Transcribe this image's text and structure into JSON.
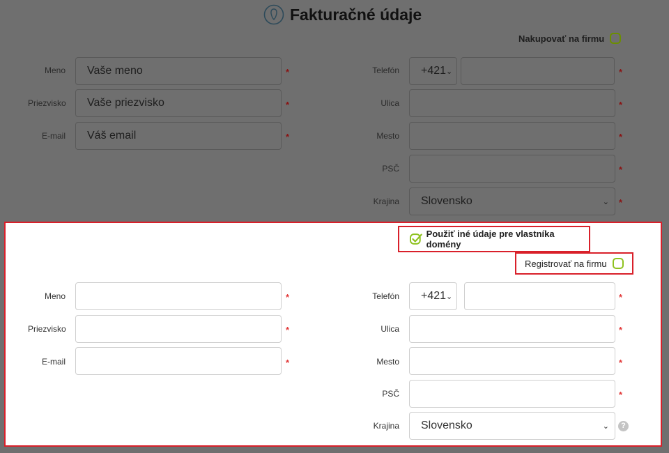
{
  "page": {
    "title": "Fakturačné údaje"
  },
  "billing": {
    "company_toggle_label": "Nakupovať na firmu",
    "labels": {
      "name": "Meno",
      "surname": "Priezvisko",
      "email": "E-mail",
      "phone": "Telefón",
      "street": "Ulica",
      "city": "Mesto",
      "zip": "PSČ",
      "country": "Krajina"
    },
    "placeholders": {
      "name": "Vaše meno",
      "surname": "Vaše priezvisko",
      "email": "Váš email"
    },
    "phone_prefix": "+421",
    "country_value": "Slovensko",
    "required_mark": "*"
  },
  "owner": {
    "use_other_label": "Použiť iné údaje pre vlastníka domény",
    "use_other_checked": true,
    "register_company_label": "Registrovať na firmu",
    "labels": {
      "name": "Meno",
      "surname": "Priezvisko",
      "email": "E-mail",
      "phone": "Telefón",
      "street": "Ulica",
      "city": "Mesto",
      "zip": "PSČ",
      "country": "Krajina"
    },
    "phone_prefix": "+421",
    "country_value": "Slovensko",
    "required_mark": "*",
    "help_glyph": "?"
  },
  "colors": {
    "accent_green": "#8ec21f",
    "highlight_red": "#d9202a",
    "required_red": "#e23a3a",
    "overlay_gray": "#6f6f6f"
  }
}
